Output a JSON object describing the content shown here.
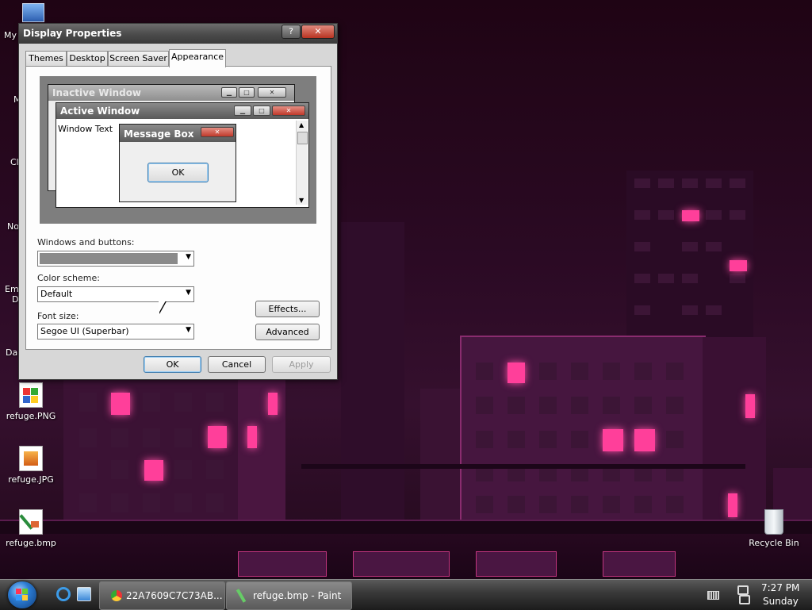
{
  "desktop": {
    "icons": [
      {
        "label": "refuge.PNG"
      },
      {
        "label": "refuge.JPG"
      },
      {
        "label": "refuge.bmp"
      },
      {
        "label": "Recycle Bin"
      }
    ],
    "edge_labels": [
      "My",
      "M",
      "Cl",
      "No",
      "Em",
      "D",
      "Da"
    ]
  },
  "dialog": {
    "title": "Display Properties",
    "help_label": "?",
    "close_label": "✕",
    "tabs": [
      {
        "label": "Themes"
      },
      {
        "label": "Desktop"
      },
      {
        "label": "Screen Saver"
      },
      {
        "label": "Appearance"
      }
    ],
    "preview": {
      "inactive_title": "Inactive Window",
      "active_title": "Active Window",
      "window_text": "Window Text",
      "message_title": "Message Box",
      "message_ok": "OK"
    },
    "windows_buttons_label": "Windows and buttons:",
    "color_scheme_label": "Color scheme:",
    "color_scheme_value": "Default",
    "font_size_label": "Font size:",
    "font_size_value": "Segoe UI (Superbar)",
    "effects_label": "Effects...",
    "advanced_label": "Advanced",
    "ok_label": "OK",
    "cancel_label": "Cancel",
    "apply_label": "Apply"
  },
  "taskbar": {
    "buttons": [
      {
        "label": "22A7609C7C73AB..."
      },
      {
        "label": "refuge.bmp - Paint"
      }
    ],
    "clock_time": "7:27 PM",
    "clock_day": "Sunday"
  },
  "colors": {
    "accent_glow": "#ff3f9a",
    "title_bar": "#4d4d4d",
    "close_red": "#c0392b"
  }
}
